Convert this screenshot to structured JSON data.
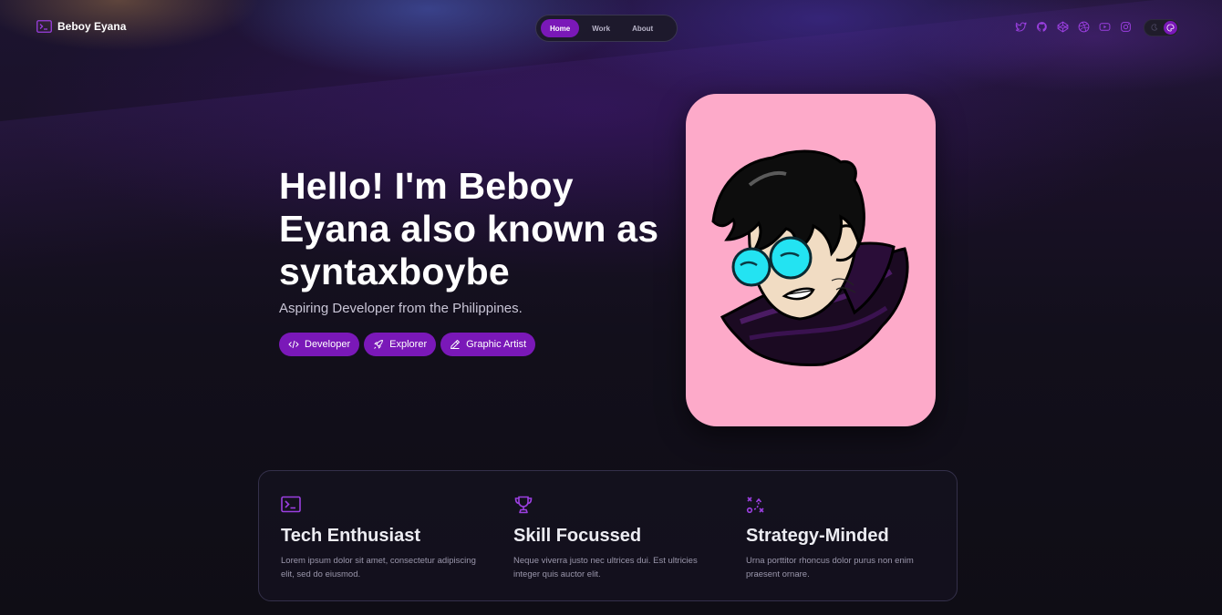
{
  "header": {
    "brand_name": "Beboy Eyana",
    "brand_icon": "terminal-icon",
    "nav": [
      {
        "label": "Home",
        "active": true
      },
      {
        "label": "Work",
        "active": false
      },
      {
        "label": "About",
        "active": false
      }
    ],
    "socials": [
      "twitter-icon",
      "github-icon",
      "codepen-icon",
      "dribbble-icon",
      "youtube-icon",
      "instagram-icon"
    ],
    "theme_toggle": {
      "state": "dark",
      "icons": [
        "moon-icon",
        "palette-icon"
      ]
    }
  },
  "hero": {
    "title": "Hello! I'm Beboy Eyana also known as syntaxboybe",
    "subtitle": "Aspiring Developer from the Philippines.",
    "tags": [
      {
        "label": "Developer",
        "icon": "code-icon"
      },
      {
        "label": "Explorer",
        "icon": "rocket-icon"
      },
      {
        "label": "Graphic Artist",
        "icon": "pencil-icon"
      }
    ],
    "portrait_bg": "#fdaac9"
  },
  "features": [
    {
      "icon": "terminal-icon",
      "title": "Tech Enthusiast",
      "description": "Lorem ipsum dolor sit amet, consectetur adipiscing elit, sed do eiusmod."
    },
    {
      "icon": "trophy-icon",
      "title": "Skill Focussed",
      "description": "Neque viverra justo nec ultrices dui. Est ultricies integer quis auctor elit."
    },
    {
      "icon": "strategy-icon",
      "title": "Strategy-Minded",
      "description": "Urna porttitor rhoncus dolor purus non enim praesent ornare."
    }
  ],
  "colors": {
    "accent": "#7a18b8",
    "background": "#0f0d15",
    "card_border": "#34304a"
  }
}
